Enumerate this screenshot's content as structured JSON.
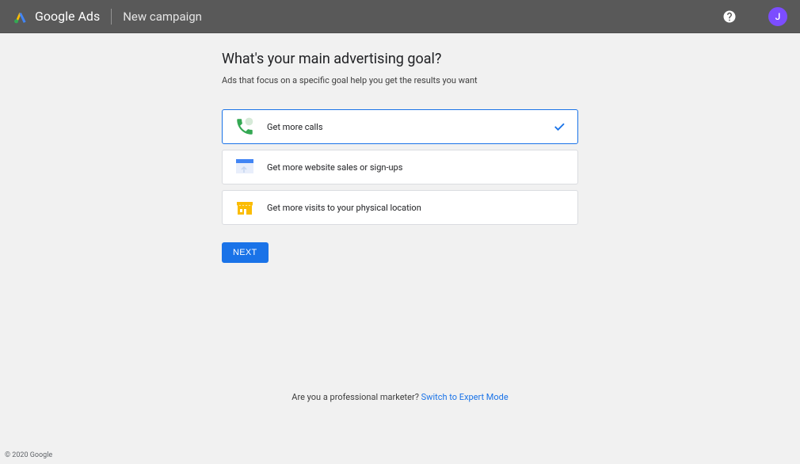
{
  "header": {
    "product": "Google Ads",
    "page_title": "New campaign",
    "avatar_letter": "J"
  },
  "main": {
    "heading": "What's your main advertising goal?",
    "subheading": "Ads that focus on a specific goal help you get the results you want",
    "options": [
      {
        "label": "Get more calls",
        "selected": true
      },
      {
        "label": "Get more website sales or sign-ups",
        "selected": false
      },
      {
        "label": "Get more visits to your physical location",
        "selected": false
      }
    ],
    "next_button": "NEXT"
  },
  "footer": {
    "prompt_text": "Are you a professional marketer? ",
    "link_text": "Switch to Expert Mode",
    "copyright": "© 2020 Google"
  }
}
